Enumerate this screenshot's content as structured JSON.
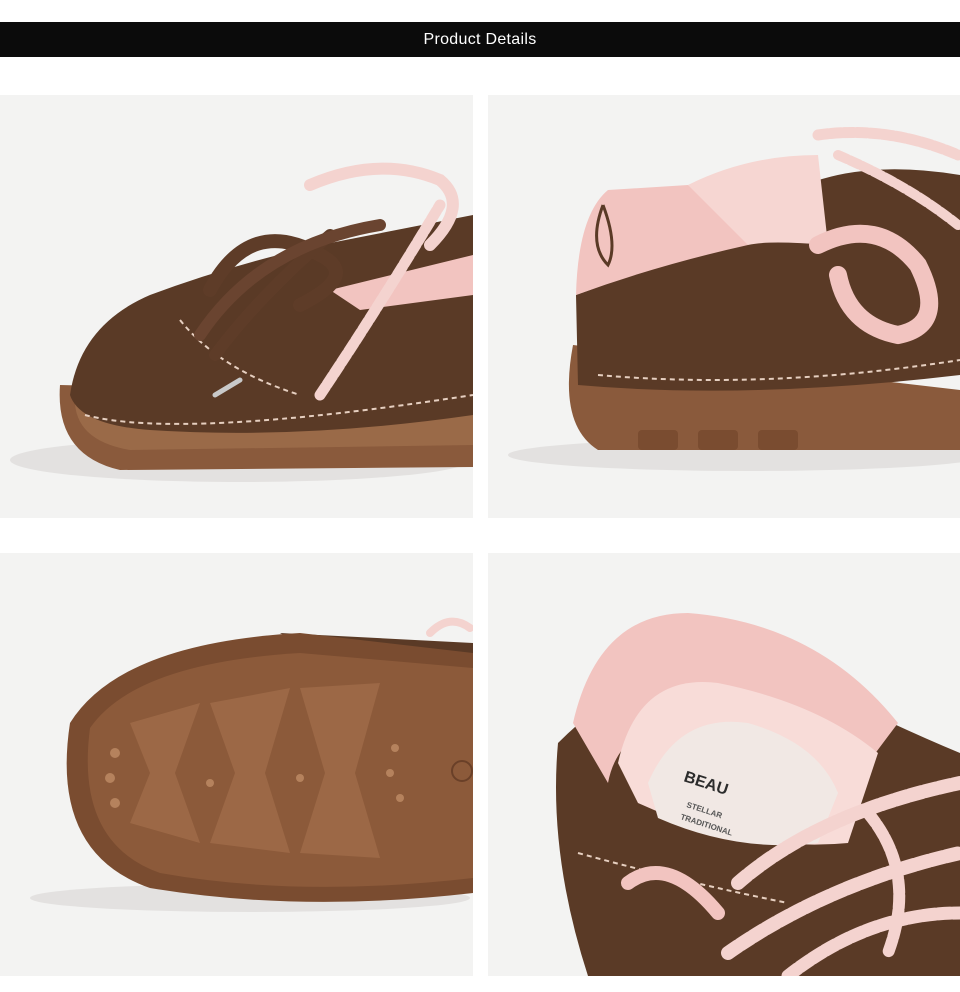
{
  "header": {
    "title": "Product Details"
  },
  "colors": {
    "header_bg": "#0b0b0b",
    "tile_bg": "#f3f3f2",
    "suede_brown": "#5a3a26",
    "sole_gum": "#8a5a3c",
    "accent_pink": "#f2c4c0",
    "lace_pink": "#f4d3cf"
  },
  "gallery": [
    {
      "icon": "shoe-toe-laces-closeup-image"
    },
    {
      "icon": "shoe-heel-side-closeup-image"
    },
    {
      "icon": "shoe-outsole-tread-image"
    },
    {
      "icon": "shoe-insole-collar-closeup-image"
    }
  ],
  "insole": {
    "brand_text": "BEAU",
    "sub_text_1": "STELLAR",
    "sub_text_2": "TRADITIONAL"
  }
}
